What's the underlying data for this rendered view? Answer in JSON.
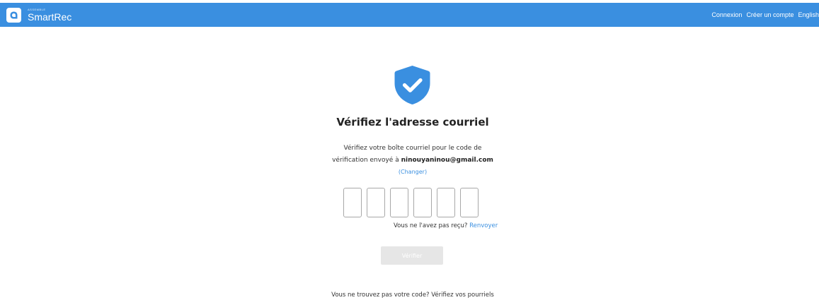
{
  "header": {
    "brand_super": "ASSEMBLE",
    "brand_name": "SmartRec",
    "nav": {
      "login": "Connexion",
      "signup": "Créer un compte",
      "language": "English"
    },
    "colors": {
      "bar": "#3a8fe0",
      "text": "#ffffff"
    }
  },
  "main": {
    "icon": "shield-check-icon",
    "title": "Vérifiez l'adresse courriel",
    "description_line1": "Vérifiez votre boîte courriel pour le code de",
    "description_line2_prefix": "vérification envoyé à",
    "email": "ninouyaninou@gmail.com",
    "change_link": "(Changer)",
    "code_inputs": [
      "",
      "",
      "",
      "",
      "",
      ""
    ],
    "resend_prompt": "Vous ne l'avez pas reçu?",
    "resend_link": "Renvoyer",
    "verify_button": "Vérifier",
    "footer_hint": "Vous ne trouvez pas votre code? Vérifiez vos pourriels",
    "colors": {
      "accent": "#3a8fe0",
      "button_disabled": "#e6e6e6"
    }
  }
}
